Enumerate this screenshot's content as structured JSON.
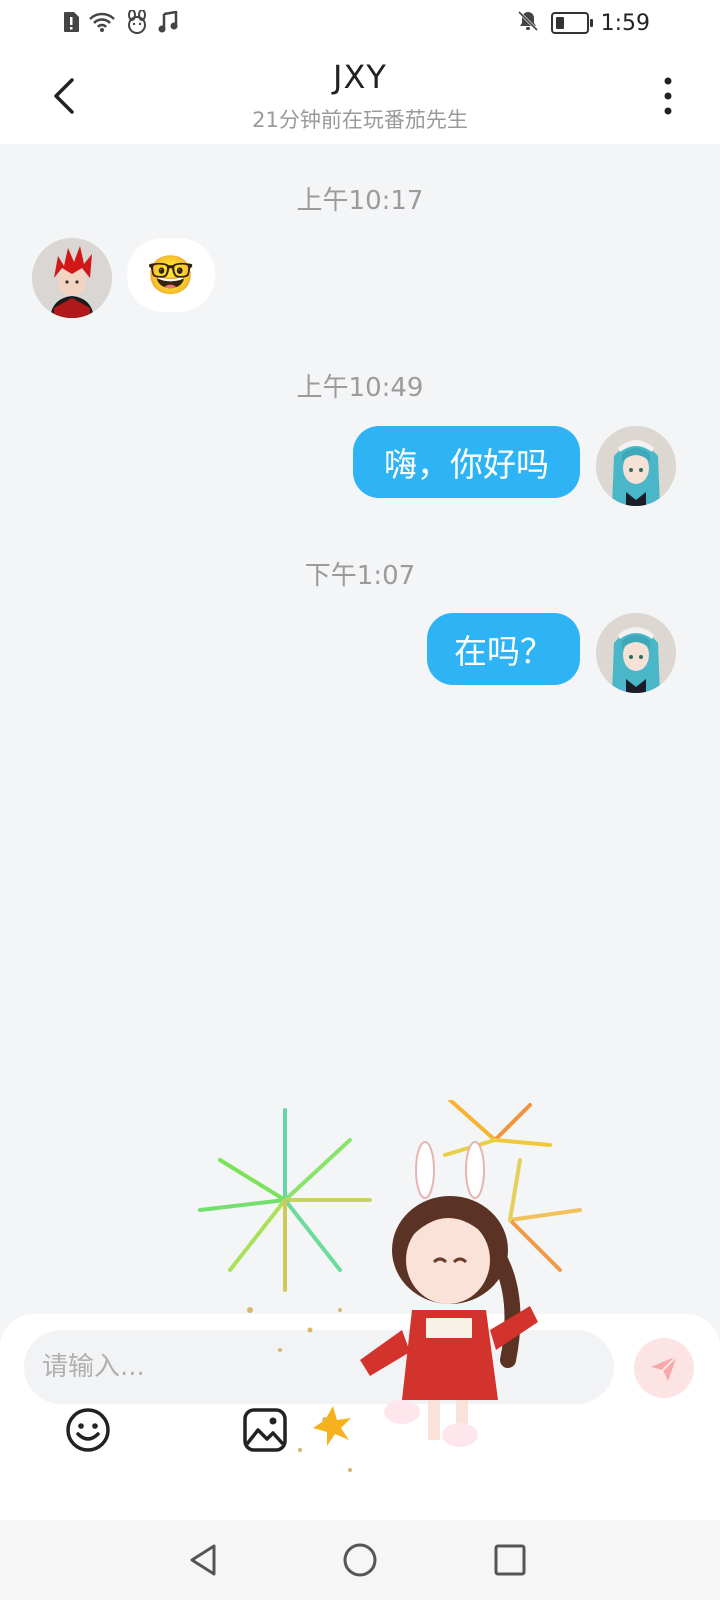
{
  "status_bar": {
    "time": "1:59",
    "icons": [
      "sim-alert-icon",
      "wifi-icon",
      "bunny-notification-icon",
      "music-icon",
      "mute-bell-icon",
      "battery-icon"
    ]
  },
  "header": {
    "title": "JXY",
    "subtitle": "21分钟前在玩番茄先生",
    "back_icon": "chevron-left-icon",
    "more_icon": "more-vertical-icon"
  },
  "messages": [
    {
      "timestamp": "上午10:17",
      "direction": "incoming",
      "content_type": "emoji",
      "emoji": "🤓"
    },
    {
      "timestamp": "上午10:49",
      "direction": "outgoing",
      "content_type": "text",
      "text": "嗨，你好吗"
    },
    {
      "timestamp": "下午1:07",
      "direction": "outgoing",
      "content_type": "text",
      "text": "在吗？"
    }
  ],
  "composer": {
    "placeholder": "请输入...",
    "value": "",
    "send_icon": "send-icon",
    "tools": [
      "emoji-icon",
      "image-icon"
    ]
  },
  "nav_bar": {
    "buttons": [
      "back-triangle-icon",
      "home-circle-icon",
      "recents-square-icon"
    ]
  },
  "colors": {
    "outgoing_bubble": "#2eb4f5",
    "incoming_bubble": "#ffffff",
    "chat_background": "#f4f5f7",
    "send_button_bg": "#fde4e4",
    "send_icon": "#f7a8a8"
  }
}
